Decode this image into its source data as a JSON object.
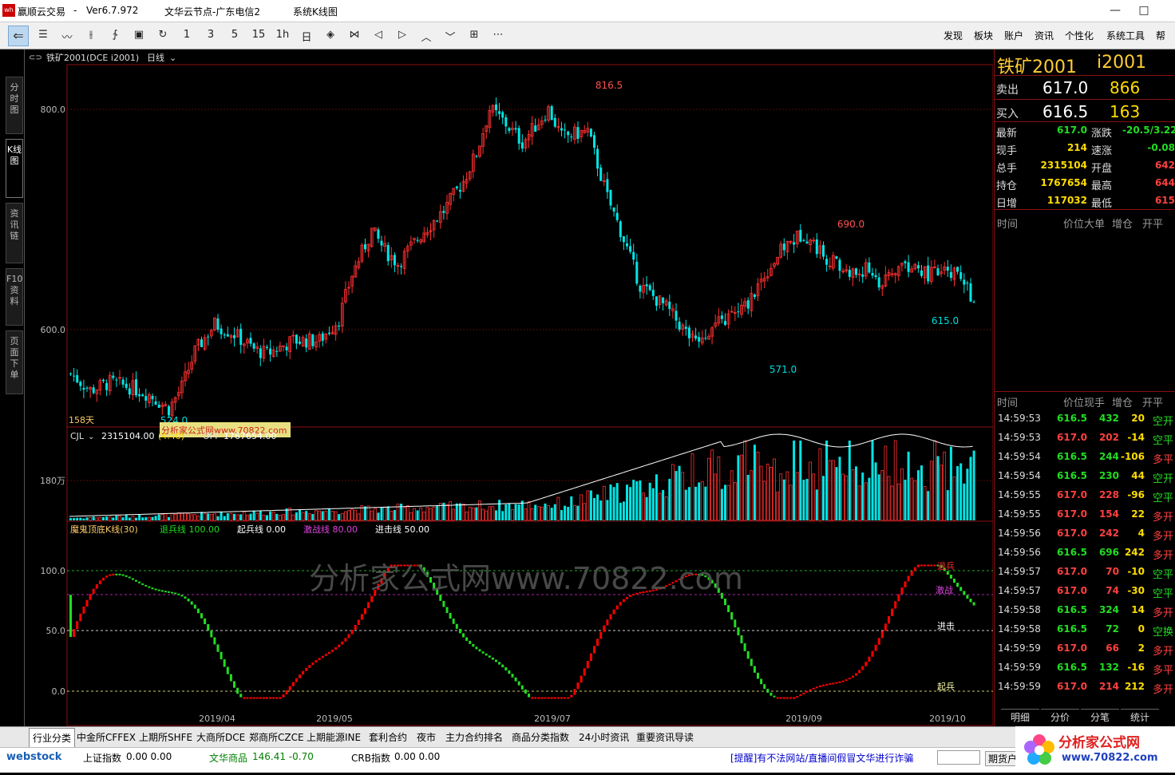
{
  "titlebar": {
    "app": "赢顺云交易",
    "version": "Ver6.7.972",
    "node": "文华云节点-广东电信2",
    "view": "系统K线图",
    "min": "—",
    "max": "□"
  },
  "toolbar": {
    "tools": [
      {
        "name": "list-icon",
        "glyph": "☰"
      },
      {
        "name": "line-chart-icon",
        "glyph": "〰"
      },
      {
        "name": "kline-icon",
        "glyph": "⫲"
      },
      {
        "name": "formula-icon",
        "glyph": "∱"
      },
      {
        "name": "save-icon",
        "glyph": "▣"
      },
      {
        "name": "refresh-icon",
        "glyph": "↻"
      },
      {
        "name": "period-1",
        "glyph": "1"
      },
      {
        "name": "period-3",
        "glyph": "3"
      },
      {
        "name": "period-5",
        "glyph": "5"
      },
      {
        "name": "period-15",
        "glyph": "15"
      },
      {
        "name": "period-1h",
        "glyph": "1h"
      },
      {
        "name": "period-day",
        "glyph": "日"
      },
      {
        "name": "zoom-in-icon",
        "glyph": "◈"
      },
      {
        "name": "zoom-out-icon",
        "glyph": "⋈"
      },
      {
        "name": "left-icon",
        "glyph": "◁"
      },
      {
        "name": "right-icon",
        "glyph": "▷"
      },
      {
        "name": "up-icon",
        "glyph": "︿"
      },
      {
        "name": "down-icon",
        "glyph": "﹀"
      },
      {
        "name": "layout-icon",
        "glyph": "⊞"
      },
      {
        "name": "more-icon",
        "glyph": "⋯"
      }
    ],
    "menus": [
      "发现",
      "板块",
      "账户",
      "资讯",
      "个性化",
      "系统工具",
      "帮"
    ]
  },
  "sidebar": {
    "tabs": [
      "分时图",
      "K线图",
      "资讯链",
      "F10资料",
      "页面下单"
    ],
    "menu_glyph": "☰"
  },
  "chart": {
    "symbol_label": "铁矿2001(DCE i2001)",
    "period": "日线",
    "price_ticks": [
      "800.0",
      "600.0"
    ],
    "annotations": {
      "high": "816.5",
      "mid_high": "690.0",
      "low1": "524.0",
      "low2": "571.0",
      "last": "615.0"
    },
    "days": "158天",
    "volume": {
      "label": "CJL",
      "value": "2315104.00",
      "extra": "(4.40)",
      "oi": "OPI",
      "oi_value": "1767654.00",
      "tick": "180万"
    },
    "indicator": {
      "name": "魔鬼顶底K线(30)",
      "l1": "退兵线 100.00",
      "l2": "起兵线 0.00",
      "l3": "激战线 80.00",
      "l4": "进击线 50.00",
      "ticks": [
        "100.0",
        "50.0",
        "0.0"
      ],
      "tags": [
        "退兵",
        "激战",
        "进击",
        "起兵"
      ]
    },
    "watermark": "分析家公式网www.70822.com",
    "label_watermark": "分析家公式网www.70822.com",
    "dates": [
      "2019/04",
      "2019/05",
      "2019/07",
      "2019/09",
      "2019/10"
    ],
    "colors": {
      "up": "#ff3030",
      "down": "#00e6e6",
      "ind_up": "#ff0000",
      "ind_down": "#22dd22"
    }
  },
  "quote": {
    "title": "铁矿2001",
    "code": "i2001",
    "ask_label": "卖出",
    "ask": "617.0",
    "ask_vol": "866",
    "bid_label": "买入",
    "bid": "616.5",
    "bid_vol": "163",
    "rows": [
      {
        "l1": "最新",
        "v1": "617.0",
        "l2": "涨跌",
        "v2": "-20.5/3.22"
      },
      {
        "l1": "现手",
        "v1": "214",
        "l2": "速涨",
        "v2": "-0.08"
      },
      {
        "l1": "总手",
        "v1": "2315104",
        "l2": "开盘",
        "v2": "642"
      },
      {
        "l1": "持仓",
        "v1": "1767654",
        "l2": "最高",
        "v2": "644"
      },
      {
        "l1": "日增",
        "v1": "117032",
        "l2": "最低",
        "v2": "615"
      }
    ],
    "big_header": [
      "时间",
      "价位",
      "大单",
      "增仓",
      "开平"
    ],
    "tick_header": [
      "时间",
      "价位",
      "现手",
      "增仓",
      "开平"
    ],
    "ticks": [
      {
        "t": "14:59:53",
        "p": "616.5",
        "v": "432",
        "d": "20",
        "k": "空开"
      },
      {
        "t": "14:59:53",
        "p": "617.0",
        "v": "202",
        "d": "-14",
        "k": "空平"
      },
      {
        "t": "14:59:54",
        "p": "616.5",
        "v": "244",
        "d": "-106",
        "k": "多平"
      },
      {
        "t": "14:59:54",
        "p": "616.5",
        "v": "230",
        "d": "44",
        "k": "空开"
      },
      {
        "t": "14:59:55",
        "p": "617.0",
        "v": "228",
        "d": "-96",
        "k": "空平"
      },
      {
        "t": "14:59:55",
        "p": "617.0",
        "v": "154",
        "d": "22",
        "k": "多开"
      },
      {
        "t": "14:59:56",
        "p": "617.0",
        "v": "242",
        "d": "4",
        "k": "多开"
      },
      {
        "t": "14:59:56",
        "p": "616.5",
        "v": "696",
        "d": "242",
        "k": "多开"
      },
      {
        "t": "14:59:57",
        "p": "617.0",
        "v": "70",
        "d": "-10",
        "k": "空平"
      },
      {
        "t": "14:59:57",
        "p": "617.0",
        "v": "74",
        "d": "-30",
        "k": "空平"
      },
      {
        "t": "14:59:58",
        "p": "616.5",
        "v": "324",
        "d": "14",
        "k": "多开"
      },
      {
        "t": "14:59:58",
        "p": "616.5",
        "v": "72",
        "d": "0",
        "k": "空换"
      },
      {
        "t": "14:59:59",
        "p": "617.0",
        "v": "66",
        "d": "2",
        "k": "多开"
      },
      {
        "t": "14:59:59",
        "p": "616.5",
        "v": "132",
        "d": "-16",
        "k": "多平"
      },
      {
        "t": "14:59:59",
        "p": "617.0",
        "v": "214",
        "d": "212",
        "k": "多开"
      }
    ],
    "bottom_tabs": [
      "明细",
      "分价",
      "分笔",
      "统计"
    ]
  },
  "bottom_tabs": [
    "行业分类",
    "中金所CFFEX",
    "上期所SHFE",
    "大商所DCE",
    "郑商所CZCE",
    "上期能源INE",
    "套利合约",
    "夜市",
    "主力合约排名",
    "商品分类指数",
    "24小时资讯",
    "重要资讯导读"
  ],
  "status": {
    "logo": "webstock",
    "i1": "上证指数",
    "i1v": "0.00  0.00",
    "i2": "文华商品",
    "i2v": "146.41  -0.70",
    "i3": "CRB指数",
    "i3v": "0.00  0.00",
    "notice": "[提醒]有不法网站/直播间假冒文华进行诈骗",
    "btn": "期货户"
  },
  "brand": {
    "text": "分析家公式网",
    "url": "www.70822.com"
  }
}
